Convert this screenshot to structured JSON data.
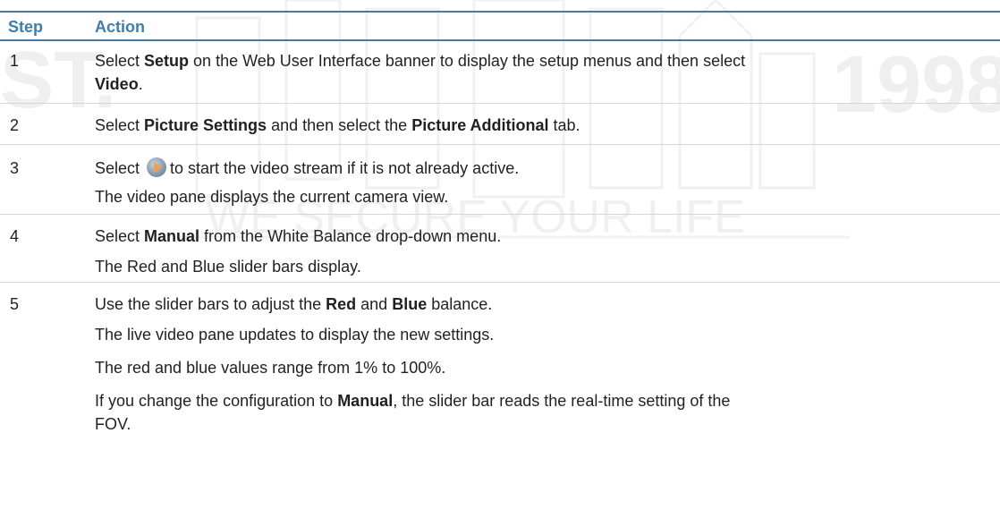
{
  "header": {
    "step": "Step",
    "action": "Action"
  },
  "watermark": {
    "left_text": "ST.",
    "center_text": "WE SECURE YOUR LIFE",
    "right_text": "1998"
  },
  "steps": [
    {
      "number": "1",
      "line1": {
        "a": "Select ",
        "b": "Setup",
        "c": " on the Web User Interface banner to display the setup menus and then select"
      },
      "line2": {
        "b": "Video",
        "c": "."
      }
    },
    {
      "number": "2",
      "line1": {
        "a": "Select ",
        "b": "Picture Settings",
        "c": " and then select the ",
        "d": "Picture Additional",
        "e": " tab."
      }
    },
    {
      "number": "3",
      "line1": {
        "a": "Select",
        "c": "to start the video stream if it is not already active."
      },
      "line2": "The video pane displays the current camera view."
    },
    {
      "number": "4",
      "line1": {
        "a": "Select ",
        "b": "Manual",
        "c": " from the White Balance drop-down menu."
      },
      "line2": "The Red and Blue slider bars display."
    },
    {
      "number": "5",
      "line1": {
        "a": "Use the slider bars to adjust the ",
        "b": "Red",
        "c": " and ",
        "d": "Blue",
        "e": " balance."
      },
      "line2": "The live video pane updates to display the new settings.",
      "line3": "The red and blue values range from 1% to 100%.",
      "line4": {
        "a": "If you change the configuration to ",
        "b": "Manual",
        "c": ", the slider bar reads the real-time setting of the"
      },
      "line5": "FOV."
    }
  ],
  "colors": {
    "header": "#3d7eaa",
    "text": "#231f20"
  }
}
